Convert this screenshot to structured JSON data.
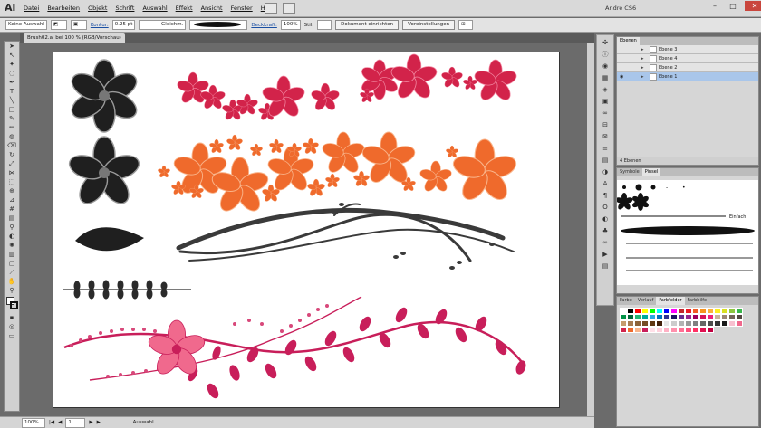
{
  "menubar": {
    "logo": "Ai",
    "items": [
      "Datei",
      "Bearbeiten",
      "Objekt",
      "Schrift",
      "Auswahl",
      "Effekt",
      "Ansicht",
      "Fenster",
      "Hilfe"
    ],
    "user": "Andre CS6"
  },
  "control": {
    "selection": "Keine Auswahl",
    "stroke_label": "Kontur:",
    "stroke_weight": "0.25 pt",
    "stroke_style": "Gleichm.",
    "opacity_label": "Deckkraft:",
    "opacity": "100%",
    "style_label": "Stil:",
    "doc_setup": "Dokument einrichten",
    "prefs": "Voreinstellungen"
  },
  "document": {
    "tab": "Brush02.ai bei 100 % (RGB/Vorschau)"
  },
  "status": {
    "zoom": "100%",
    "artboard": "1",
    "mode": "Auswahl"
  },
  "layers": {
    "title": "Ebenen",
    "rows": [
      {
        "name": "Ebene 3"
      },
      {
        "name": "Ebene 4"
      },
      {
        "name": "Ebene 2"
      },
      {
        "name": "Ebene 1"
      }
    ],
    "count": "4 Ebenen"
  },
  "brushes": {
    "tabs": [
      "Symbole",
      "Pinsel"
    ],
    "basic_label": "Einfach"
  },
  "swatches": {
    "tabs": [
      "Farbe",
      "Verlauf",
      "Farbfelder",
      "Farbhilfe"
    ]
  },
  "colors": {
    "flower_red": "#d2234a",
    "flower_orange": "#ef6a2c",
    "dark": "#2b2b2b",
    "pink": "#c81e5a",
    "pink_light": "#f0698d"
  }
}
